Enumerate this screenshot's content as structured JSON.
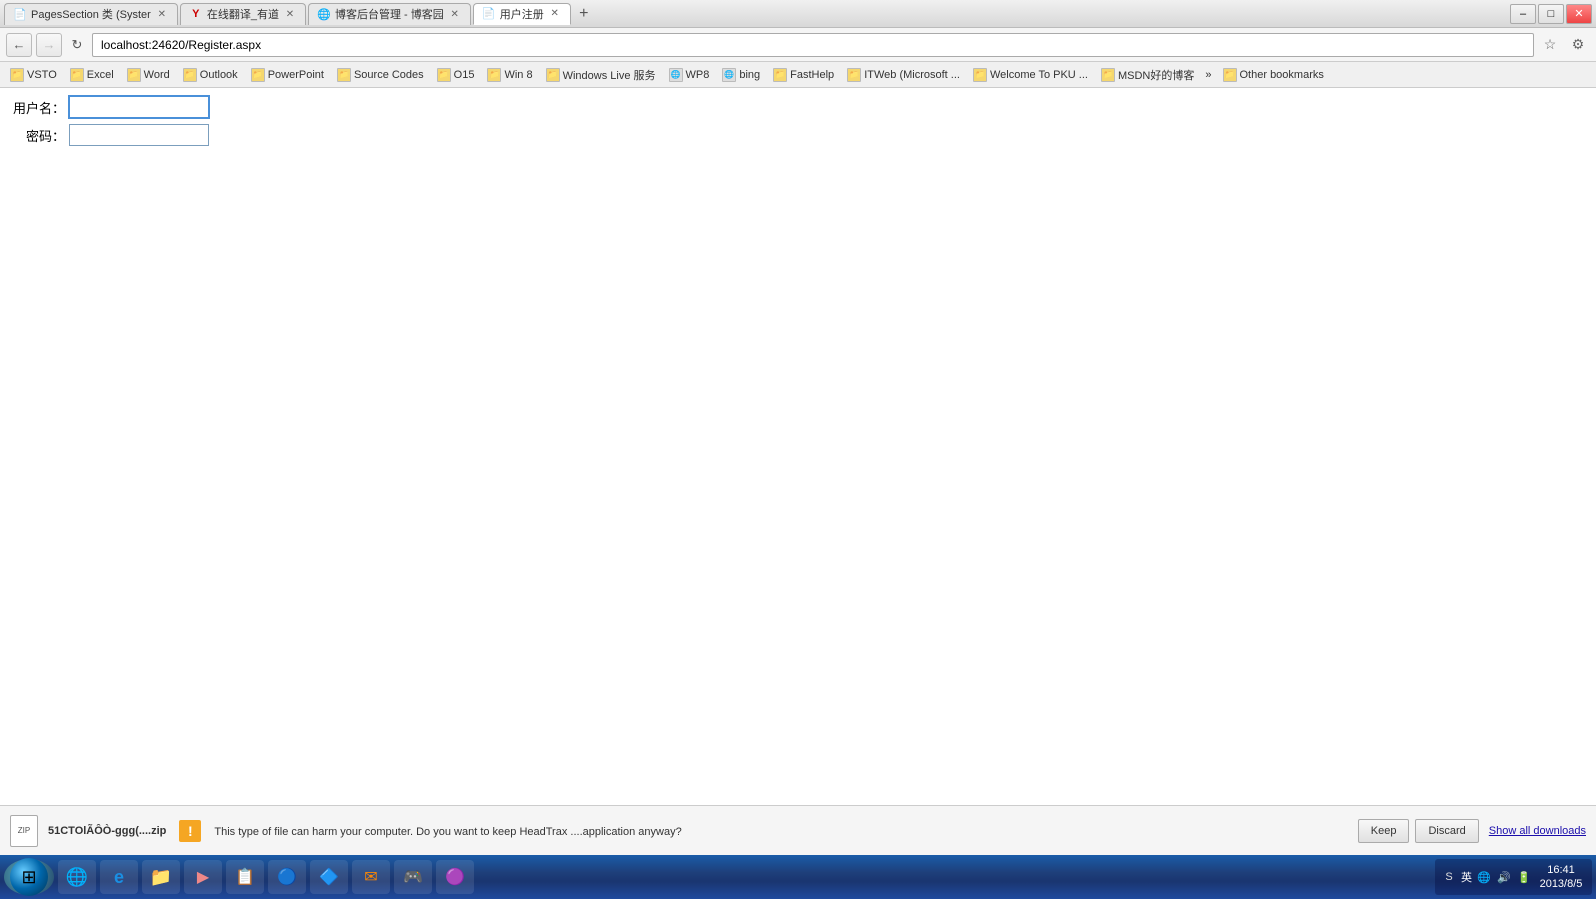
{
  "browser": {
    "tabs": [
      {
        "id": "tab1",
        "title": "PagesSection 类 (Syster",
        "favicon": "page",
        "active": false,
        "closable": true
      },
      {
        "id": "tab2",
        "title": "在线翻译_有道",
        "favicon": "y",
        "active": false,
        "closable": true
      },
      {
        "id": "tab3",
        "title": "博客后台管理 - 博客园",
        "favicon": "blog",
        "active": false,
        "closable": true
      },
      {
        "id": "tab4",
        "title": "用户注册",
        "favicon": "page",
        "active": true,
        "closable": true
      }
    ],
    "address": "localhost:24620/Register.aspx",
    "window_buttons": {
      "minimize": "–",
      "maximize": "□",
      "close": "✕"
    }
  },
  "bookmarks": [
    {
      "label": "VSTO",
      "type": "folder"
    },
    {
      "label": "Excel",
      "type": "folder"
    },
    {
      "label": "Word",
      "type": "folder"
    },
    {
      "label": "Outlook",
      "type": "folder"
    },
    {
      "label": "PowerPoint",
      "type": "folder"
    },
    {
      "label": "Source Codes",
      "type": "folder"
    },
    {
      "label": "O15",
      "type": "folder"
    },
    {
      "label": "Win 8",
      "type": "folder"
    },
    {
      "label": "Windows Live 服务",
      "type": "folder"
    },
    {
      "label": "WP8",
      "type": "bookmark"
    },
    {
      "label": "bing",
      "type": "bookmark"
    },
    {
      "label": "FastHelp",
      "type": "folder"
    },
    {
      "label": "ITWeb (Microsoft ...",
      "type": "folder"
    },
    {
      "label": "Welcome To PKU ...",
      "type": "folder"
    },
    {
      "label": "MSDN好的博客",
      "type": "folder"
    },
    {
      "label": "Other bookmarks",
      "type": "folder"
    }
  ],
  "page": {
    "title": "用户注册",
    "form": {
      "username_label": "用户名：",
      "password_label": "密码：",
      "username_value": "",
      "password_value": ""
    }
  },
  "download_bar": {
    "filename": "51CTOlÃÔÒ-ggg(....zip",
    "warning_text": "This type of file can harm your computer. Do you want to keep HeadTrax ....application anyway?",
    "keep_label": "Keep",
    "discard_label": "Discard",
    "show_all_label": "Show all downloads"
  },
  "taskbar": {
    "apps": [
      {
        "name": "start",
        "icon": "⊞"
      },
      {
        "name": "chrome",
        "icon": "🌐"
      },
      {
        "name": "ie",
        "icon": "e"
      },
      {
        "name": "explorer",
        "icon": "📁"
      },
      {
        "name": "media",
        "icon": "▶"
      },
      {
        "name": "app5",
        "icon": "📋"
      },
      {
        "name": "app6",
        "icon": "🔵"
      },
      {
        "name": "app7",
        "icon": "🔷"
      },
      {
        "name": "app8",
        "icon": "✉"
      },
      {
        "name": "app9",
        "icon": "🎮"
      },
      {
        "name": "app10",
        "icon": "🟣"
      }
    ],
    "tray": {
      "ime_label": "英",
      "time": "16:41",
      "date": "2013/8/5"
    }
  }
}
